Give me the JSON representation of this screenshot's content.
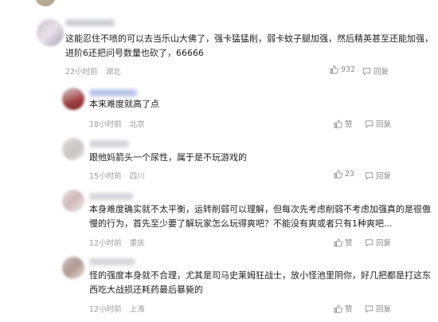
{
  "comments": [
    {
      "text_lines": [
        "这能忍住不喷的可以去当乐山大佛了，强卡猛猛削，弱卡蚊子腿加强，然后精英甚至还能加强，",
        "进阶6还把问号数量也砍了，66666"
      ],
      "time": "22小时前",
      "location": "湖北",
      "like_label": "932",
      "reply_label": "回复"
    },
    {
      "text_lines": [
        "本来难度就高了点"
      ],
      "time": "18小时前",
      "location": "北京",
      "like_label": "赞",
      "reply_label": "回复"
    },
    {
      "text_lines": [
        "跟他妈箭头一个尿性，属于是不玩游戏的"
      ],
      "time": "15小时前",
      "location": "四川",
      "like_label": "23",
      "reply_label": "回复"
    },
    {
      "text_lines": [
        "本身难度确实就不太平衡，运转削弱可以理解，但每次先考虑削弱不考虑加强真的是很傲",
        "慢的行为，首先至少要了解玩家怎么玩得爽吧？不能没有爽或者只有1种爽吧..."
      ],
      "time": "12小时前",
      "location": "重庆",
      "like_label": "赞",
      "reply_label": "回复"
    },
    {
      "text_lines": [
        "怪的强度本身就不合理，尤其是司马史莱姆狂战士，放小怪池里阴你，好几把都是打这东",
        "西吃大战损还耗药最后暴毙的"
      ],
      "time": "12小时前",
      "location": "上海",
      "like_label": "赞",
      "reply_label": "回复"
    }
  ]
}
